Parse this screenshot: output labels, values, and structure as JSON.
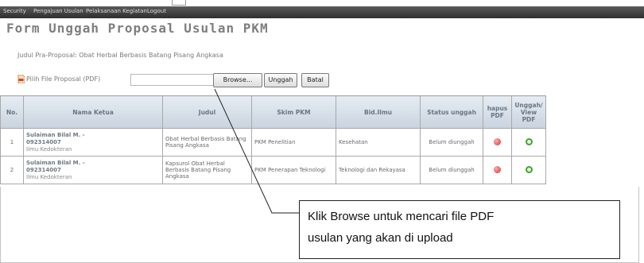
{
  "nav": {
    "items": [
      "Security",
      "Pengajuan Usulan",
      "Pelaksanaan Kegiatan",
      "Logout"
    ]
  },
  "page": {
    "title": "Form Unggah Proposal Usulan PKM",
    "judul_line": "Judul Pra-Proposal: Obat Herbal Berbasis Batang Pisang Angkasa"
  },
  "upload": {
    "file_label": "Pilih File Proposal (PDF)",
    "browse_label": "Browse...",
    "upload_label": "Unggah",
    "cancel_label": "Batal"
  },
  "table": {
    "headers": [
      "No.",
      "Nama Ketua",
      "Judul",
      "Skim PKM",
      "Bid.Ilmu",
      "Status unggah",
      "hapus PDF",
      "Unggah/ View PDF"
    ],
    "rows": [
      {
        "no": "1",
        "nama": "Sulaiman Bilal M. -",
        "nim": "092314007",
        "prodi": "Ilmu Kedokteran",
        "judul": "Obat Herbal Berbasis Batang Pisang Angkasa",
        "skim": "PKM Penelitian",
        "bidang": "Kesehatan",
        "status": "Belum diunggah"
      },
      {
        "no": "2",
        "nama": "Sulaiman Bilal M. -",
        "nim": "092314007",
        "prodi": "Ilmu Kedokteran",
        "judul": "Kapsurol Obat Herbal Berbasis Batang Pisang Angkasa",
        "skim": "PKM Penerapan Teknologi",
        "bidang": "Teknologi dan Rekayasa",
        "status": "Belum diunggah"
      }
    ]
  },
  "callout": {
    "line1": "Klik Browse untuk mencari file PDF",
    "line2": "usulan yang akan di upload"
  },
  "colors": {
    "status_red": "#e06060",
    "delete_red": "#d92a2a",
    "upload_green": "#3fa62a",
    "header_bg": "#c9d3de",
    "nav_bg": "#2e2e2e"
  }
}
